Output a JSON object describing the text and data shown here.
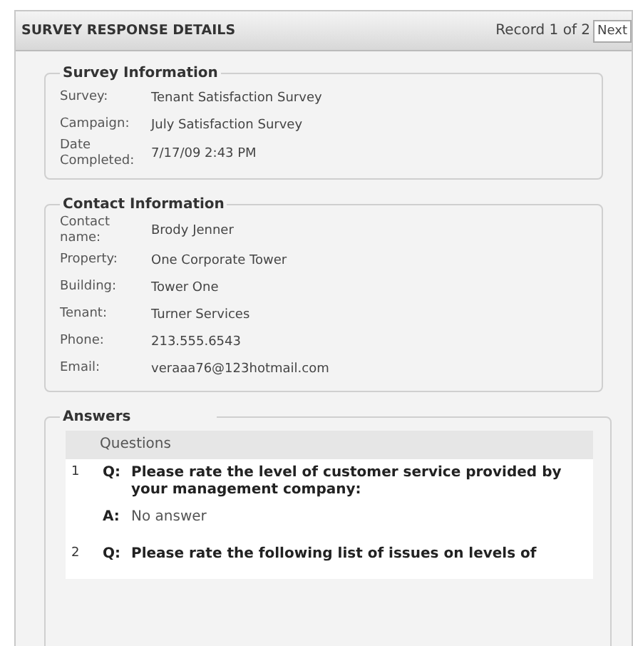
{
  "header": {
    "title": "SURVEY RESPONSE DETAILS",
    "record": "Record 1 of 2",
    "next_button": "Next"
  },
  "sections": [
    {
      "title": "Survey Information",
      "fields": [
        {
          "label": "Survey:",
          "value": "Tenant Satisfaction Survey"
        },
        {
          "label": "Campaign:",
          "value": "July Satisfaction Survey"
        },
        {
          "label": "Date Completed:",
          "value": "7/17/09 2:43 PM"
        }
      ]
    },
    {
      "title": "Contact Information",
      "fields": [
        {
          "label": "Contact name:",
          "value": "Brody Jenner"
        },
        {
          "label": "Property:",
          "value": "One Corporate Tower"
        },
        {
          "label": "Building:",
          "value": "Tower One"
        },
        {
          "label": "Tenant:",
          "value": "Turner Services"
        },
        {
          "label": "Phone:",
          "value": "213.555.6543"
        },
        {
          "label": "Email:",
          "value": "veraaa76@123hotmail.com"
        }
      ]
    }
  ],
  "answers": {
    "title": "Answers",
    "column": "Questions",
    "rows": [
      {
        "number": "1",
        "q_mark": "Q:",
        "question": "Please rate the level of customer service provided by your management company:",
        "a_mark": "A:",
        "answer": "No answer"
      },
      {
        "number": "2",
        "q_mark": "Q:",
        "question": "Please rate the following list of issues on levels of"
      }
    ]
  }
}
